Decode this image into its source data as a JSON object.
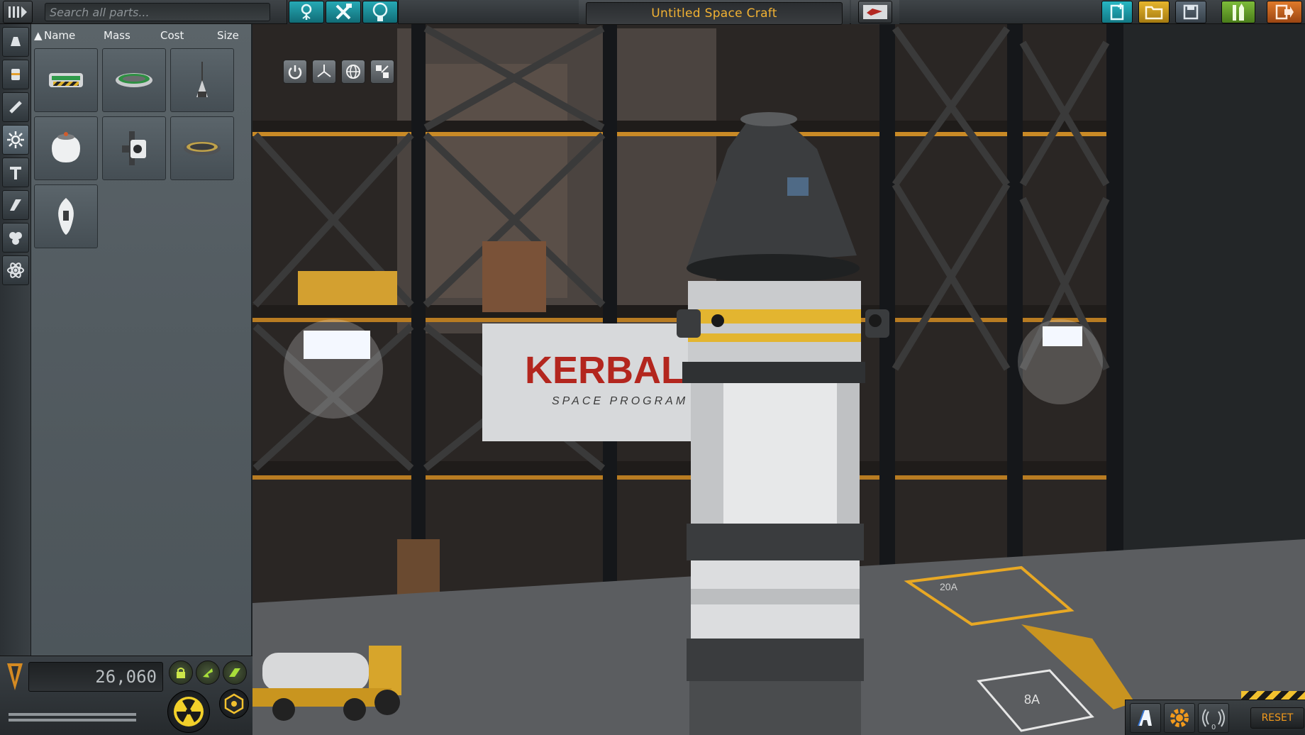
{
  "toolbar": {
    "search_placeholder": "Search all parts...",
    "craft_name": "Untitled Space Craft",
    "mode_buttons": [
      "Place",
      "Edit",
      "Crew"
    ],
    "right_buttons": [
      "new-craft",
      "load-craft",
      "save-craft",
      "launch",
      "exit"
    ]
  },
  "categories": [
    "pods",
    "fuel-tanks",
    "engines",
    "control",
    "structural",
    "aerodynamics",
    "utility",
    "science"
  ],
  "active_category": "control",
  "parts_panel": {
    "sort_columns": [
      "Name",
      "Mass",
      "Cost",
      "Size"
    ],
    "sort_active": "Name",
    "parts": [
      {
        "icon": "decoupler-striped-icon"
      },
      {
        "icon": "ring-decoupler-icon"
      },
      {
        "icon": "nose-cone-icon"
      },
      {
        "icon": "reaction-wheel-pod-icon"
      },
      {
        "icon": "rcs-block-icon"
      },
      {
        "icon": "docking-ring-icon"
      },
      {
        "icon": "probe-core-icon"
      }
    ]
  },
  "status": {
    "funds": "26,060"
  },
  "gizmo_buttons": [
    "place-tool",
    "offset-tool",
    "rotate-tool",
    "root-tool"
  ],
  "bottom_right": {
    "comm_count": "0",
    "reset_label": "RESET"
  },
  "scene": {
    "banner_title": "KERBAL",
    "banner_subtitle": "SPACE PROGRAM",
    "pad_label_a": "20A",
    "pad_label_b": "8A"
  },
  "colors": {
    "accent_cyan": "#26a9b5",
    "accent_orange": "#f2b233",
    "launch_green": "#7dbc3a"
  }
}
